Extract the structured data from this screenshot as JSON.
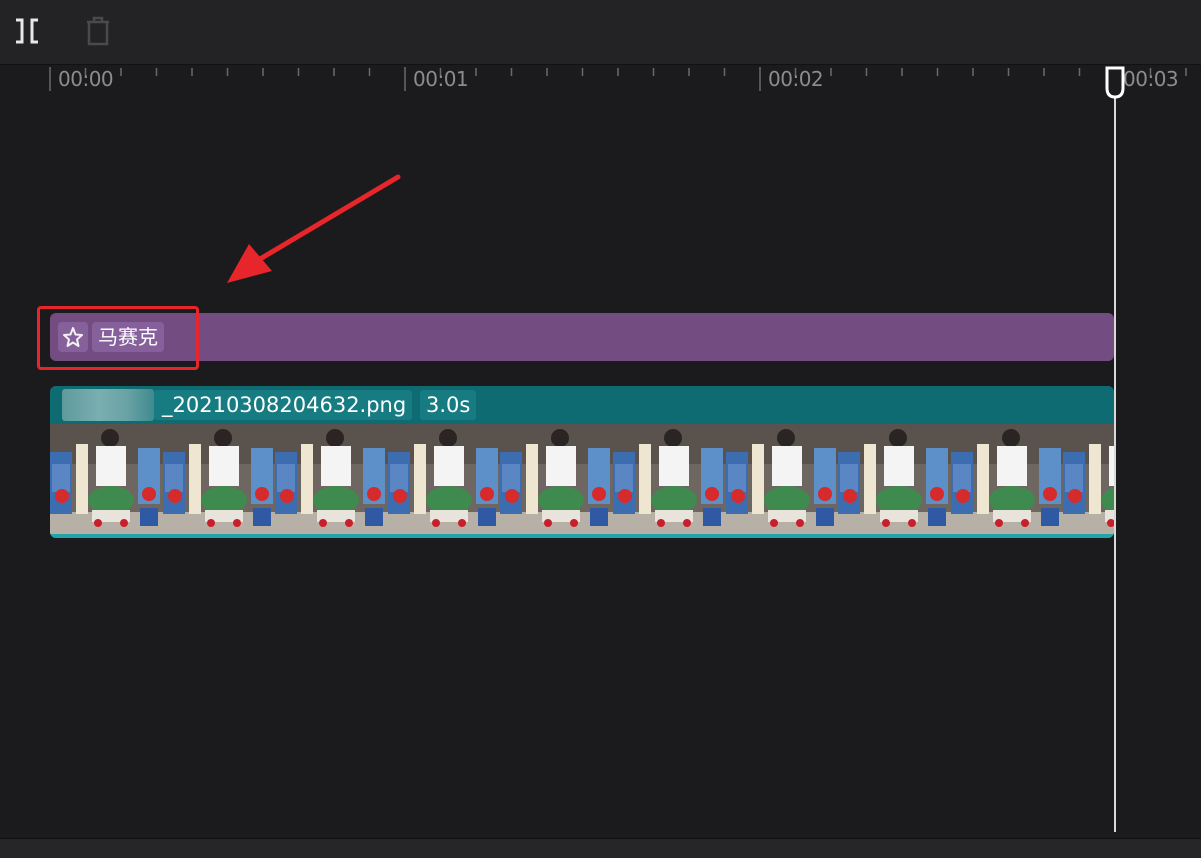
{
  "toolbar": {
    "split_icon": "split-icon",
    "delete_icon": "trash-icon"
  },
  "ruler": {
    "labels": [
      "00:00",
      "00:01",
      "00:02",
      "00:03"
    ]
  },
  "tracks": {
    "effect": {
      "icon": "sparkle-icon",
      "label": "马赛克",
      "color": "#734d82"
    },
    "video": {
      "filename": "_20210308204632.png",
      "duration": "3.0s",
      "color": "#0d6b70"
    }
  },
  "playhead": {
    "time": "00:03"
  },
  "annotation": {
    "highlight_color": "#e6262a"
  }
}
